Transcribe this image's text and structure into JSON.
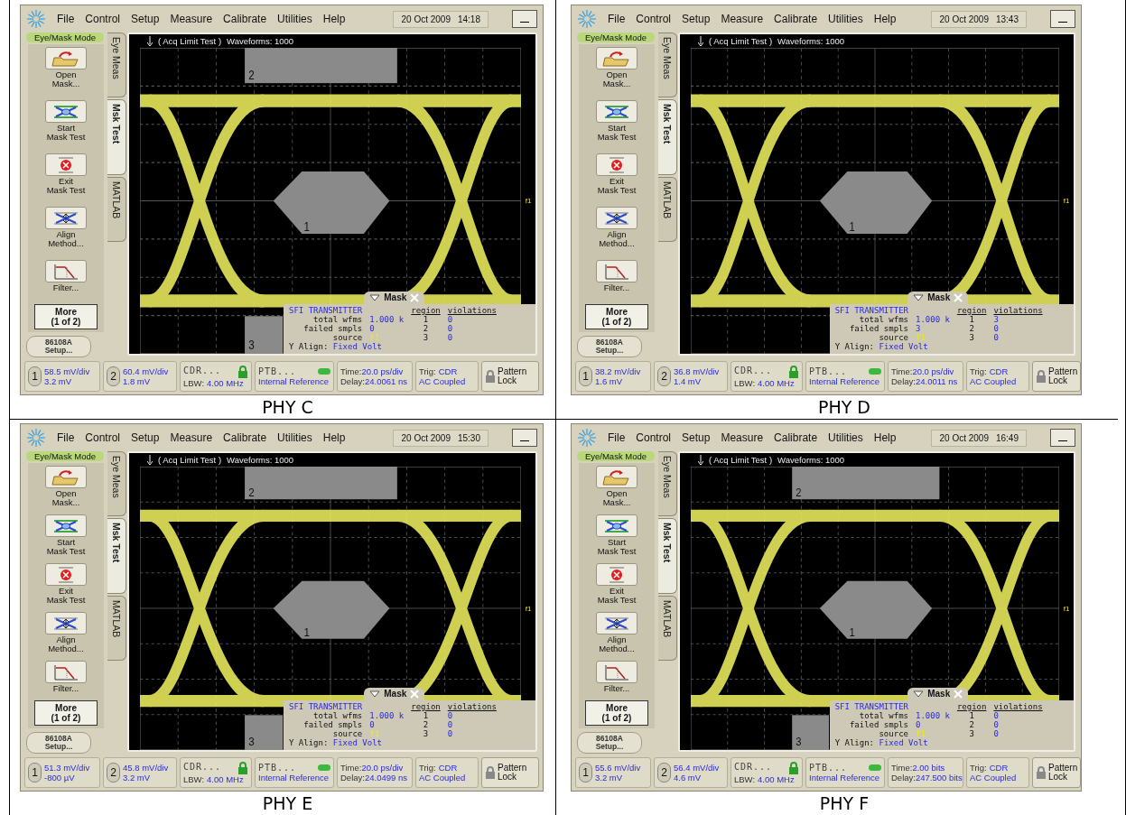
{
  "panels": [
    {
      "caption": "PHY C",
      "menu": [
        "File",
        "Control",
        "Setup",
        "Measure",
        "Calibrate",
        "Utilities",
        "Help"
      ],
      "date": "20 Oct 2009",
      "time": "14:18",
      "mode": "Eye/Mask Mode",
      "tools": [
        {
          "kind": "open",
          "label": [
            "Open",
            "Mask..."
          ]
        },
        {
          "kind": "start",
          "label": [
            "Start",
            "Mask Test"
          ]
        },
        {
          "kind": "exit",
          "label": [
            "Exit",
            "Mask Test"
          ]
        },
        {
          "kind": "align",
          "label": [
            "Align",
            "Method..."
          ]
        },
        {
          "kind": "filter",
          "label": [
            "Filter..."
          ]
        }
      ],
      "more": [
        "More",
        "(1 of 2)"
      ],
      "setup": [
        "86108A",
        "Setup..."
      ],
      "tabs": [
        {
          "label": "Eye Meas",
          "selected": false
        },
        {
          "label": "Msk Test",
          "selected": true
        },
        {
          "label": "MATLAB",
          "selected": false
        }
      ],
      "acq": "( Acq Limit Test )",
      "waveforms": "Waveforms: 1000",
      "regions": [
        {
          "kind": "top",
          "label": "2"
        },
        {
          "kind": "center",
          "label": "1"
        },
        {
          "kind": "bottom",
          "label": "3"
        }
      ],
      "marker": "f1",
      "mask": {
        "tab": "Mask",
        "title": "SFI TRANSMITTER",
        "region_head": "region",
        "violations_head": "violations",
        "rows": [
          {
            "label": "total wfms",
            "value": "1.000 k",
            "region": "1",
            "violations": "0"
          },
          {
            "label": "failed smpls",
            "value": "0",
            "region": "2",
            "violations": "0"
          },
          {
            "label": "source",
            "value": "f1",
            "region": "3",
            "violations": "0"
          }
        ],
        "align_label": "Y Align:",
        "align_value": "Fixed Volt"
      },
      "status": {
        "ch1": {
          "num": "1",
          "scale": "58.5 mV/div",
          "offset": "3.2 mV"
        },
        "ch2": {
          "num": "2",
          "scale": "60.4 mV/div",
          "offset": "1.8 mV"
        },
        "cdr": {
          "title": "CDR...",
          "label": "LBW:",
          "value": "4.00 MHz"
        },
        "ptb": {
          "title": "PTB...",
          "value": "Internal Reference"
        },
        "time_label": "Time:",
        "time": "20.0 ps/div",
        "delay_label": "Delay:",
        "delay": "24.0061 ns",
        "trig_label": "Trig:",
        "trig": "CDR",
        "coupling": "AC Coupled",
        "lock": [
          "Pattern",
          "Lock"
        ]
      }
    },
    {
      "caption": "PHY D",
      "menu": [
        "File",
        "Control",
        "Setup",
        "Measure",
        "Calibrate",
        "Utilities",
        "Help"
      ],
      "date": "20 Oct 2009",
      "time": "13:43",
      "mode": "Eye/Mask Mode",
      "tools": [
        {
          "kind": "open",
          "label": [
            "Open",
            "Mask..."
          ]
        },
        {
          "kind": "start",
          "label": [
            "Start",
            "Mask Test"
          ]
        },
        {
          "kind": "exit",
          "label": [
            "Exit",
            "Mask Test"
          ]
        },
        {
          "kind": "align",
          "label": [
            "Align",
            "Method..."
          ]
        },
        {
          "kind": "filter",
          "label": [
            "Filter..."
          ]
        }
      ],
      "more": [
        "More",
        "(1 of 2)"
      ],
      "setup": [
        "86108A",
        "Setup..."
      ],
      "tabs": [
        {
          "label": "Eye Meas",
          "selected": false
        },
        {
          "label": "Msk Test",
          "selected": true
        },
        {
          "label": "MATLAB",
          "selected": false
        }
      ],
      "acq": "( Acq Limit Test )",
      "waveforms": "Waveforms: 1000",
      "regions": [
        {
          "kind": "center",
          "label": "1"
        }
      ],
      "marker": "f1",
      "mask": {
        "tab": "Mask",
        "title": "SFI TRANSMITTER",
        "region_head": "region",
        "violations_head": "violations",
        "rows": [
          {
            "label": "total wfms",
            "value": "1.000 k",
            "region": "1",
            "violations": "3"
          },
          {
            "label": "failed smpls",
            "value": "3",
            "region": "2",
            "violations": "0"
          },
          {
            "label": "source",
            "value": "f1",
            "region": "3",
            "violations": "0"
          }
        ],
        "align_label": "Y Align:",
        "align_value": "Fixed Volt"
      },
      "status": {
        "ch1": {
          "num": "1",
          "scale": "38.2 mV/div",
          "offset": "1.6 mV"
        },
        "ch2": {
          "num": "2",
          "scale": "36.8 mV/div",
          "offset": "1.4 mV"
        },
        "cdr": {
          "title": "CDR...",
          "label": "LBW:",
          "value": "4.00 MHz"
        },
        "ptb": {
          "title": "PTB...",
          "value": "Internal Reference"
        },
        "time_label": "Time:",
        "time": "20.0 ps/div",
        "delay_label": "Delay:",
        "delay": "24.0011 ns",
        "trig_label": "Trig:",
        "trig": "CDR",
        "coupling": "AC Coupled",
        "lock": [
          "Pattern",
          "Lock"
        ]
      }
    },
    {
      "caption": "PHY E",
      "menu": [
        "File",
        "Control",
        "Setup",
        "Measure",
        "Calibrate",
        "Utilities",
        "Help"
      ],
      "date": "20 Oct 2009",
      "time": "15:30",
      "mode": "Eye/Mask Mode",
      "tools": [
        {
          "kind": "open",
          "label": [
            "Open",
            "Mask..."
          ]
        },
        {
          "kind": "start",
          "label": [
            "Start",
            "Mask Test"
          ]
        },
        {
          "kind": "exit",
          "label": [
            "Exit",
            "Mask Test"
          ]
        },
        {
          "kind": "align",
          "label": [
            "Align",
            "Method..."
          ]
        },
        {
          "kind": "filter",
          "label": [
            "Filter..."
          ]
        }
      ],
      "more": [
        "More",
        "(1 of 2)"
      ],
      "setup": [
        "86108A",
        "Setup..."
      ],
      "tabs": [
        {
          "label": "Eye Meas",
          "selected": false
        },
        {
          "label": "Msk Test",
          "selected": true
        },
        {
          "label": "MATLAB",
          "selected": false
        }
      ],
      "acq": "( Acq Limit Test )",
      "waveforms": "Waveforms: 1000",
      "regions": [
        {
          "kind": "top",
          "label": "2"
        },
        {
          "kind": "center",
          "label": "1"
        },
        {
          "kind": "bottom",
          "label": "3"
        }
      ],
      "marker": "f1",
      "mask": {
        "tab": "Mask",
        "title": "SFI TRANSMITTER",
        "region_head": "region",
        "violations_head": "violations",
        "rows": [
          {
            "label": "total wfms",
            "value": "1.000 k",
            "region": "1",
            "violations": "0"
          },
          {
            "label": "failed smpls",
            "value": "0",
            "region": "2",
            "violations": "0"
          },
          {
            "label": "source",
            "value": "f1",
            "region": "3",
            "violations": "0"
          }
        ],
        "align_label": "Y Align:",
        "align_value": "Fixed Volt"
      },
      "status": {
        "ch1": {
          "num": "1",
          "scale": "51.3 mV/div",
          "offset": "-800 µV"
        },
        "ch2": {
          "num": "2",
          "scale": "45.8 mV/div",
          "offset": "3.2 mV"
        },
        "cdr": {
          "title": "CDR...",
          "label": "LBW:",
          "value": "4.00 MHz"
        },
        "ptb": {
          "title": "PTB...",
          "value": "Internal Reference"
        },
        "time_label": "Time:",
        "time": "20.0 ps/div",
        "delay_label": "Delay:",
        "delay": "24.0499 ns",
        "trig_label": "Trig:",
        "trig": "CDR",
        "coupling": "AC Coupled",
        "lock": [
          "Pattern",
          "Lock"
        ]
      }
    },
    {
      "caption": "PHY F",
      "menu": [
        "File",
        "Control",
        "Setup",
        "Measure",
        "Calibrate",
        "Utilities",
        "Help"
      ],
      "date": "20 Oct 2009",
      "time": "16:49",
      "mode": "Eye/Mask Mode",
      "tools": [
        {
          "kind": "open",
          "label": [
            "Open",
            "Mask..."
          ]
        },
        {
          "kind": "start",
          "label": [
            "Start",
            "Mask Test"
          ]
        },
        {
          "kind": "exit",
          "label": [
            "Exit",
            "Mask Test"
          ]
        },
        {
          "kind": "align",
          "label": [
            "Align",
            "Method..."
          ]
        },
        {
          "kind": "filter",
          "label": [
            "Filter..."
          ]
        }
      ],
      "more": [
        "More",
        "(1 of 2)"
      ],
      "setup": [
        "86108A",
        "Setup..."
      ],
      "tabs": [
        {
          "label": "Eye Meas",
          "selected": false
        },
        {
          "label": "Msk Test",
          "selected": true
        },
        {
          "label": "MATLAB",
          "selected": false
        }
      ],
      "acq": "( Acq Limit Test )",
      "waveforms": "Waveforms: 1000",
      "regions": [
        {
          "kind": "top",
          "label": "2"
        },
        {
          "kind": "center",
          "label": "1"
        },
        {
          "kind": "bottom",
          "label": "3"
        }
      ],
      "marker": "f1",
      "mask": {
        "tab": "Mask",
        "title": "SFI TRANSMITTER",
        "region_head": "region",
        "violations_head": "violations",
        "rows": [
          {
            "label": "total wfms",
            "value": "1.000 k",
            "region": "1",
            "violations": "0"
          },
          {
            "label": "failed smpls",
            "value": "0",
            "region": "2",
            "violations": "0"
          },
          {
            "label": "source",
            "value": "f1",
            "region": "3",
            "violations": "0"
          }
        ],
        "align_label": "Y Align:",
        "align_value": "Fixed Volt"
      },
      "status": {
        "ch1": {
          "num": "1",
          "scale": "55.6 mV/div",
          "offset": "3.2 mV"
        },
        "ch2": {
          "num": "2",
          "scale": "56.4 mV/div",
          "offset": "4.6 mV"
        },
        "cdr": {
          "title": "CDR...",
          "label": "LBW:",
          "value": "4.00 MHz"
        },
        "ptb": {
          "title": "PTB...",
          "value": "Internal Reference"
        },
        "time_label": "Time:",
        "time": "2.00 bits",
        "delay_label": "Delay:",
        "delay": "247.500 bits",
        "trig_label": "Trig:",
        "trig": "CDR",
        "coupling": "AC Coupled",
        "lock": [
          "Pattern",
          "Lock"
        ]
      }
    }
  ]
}
